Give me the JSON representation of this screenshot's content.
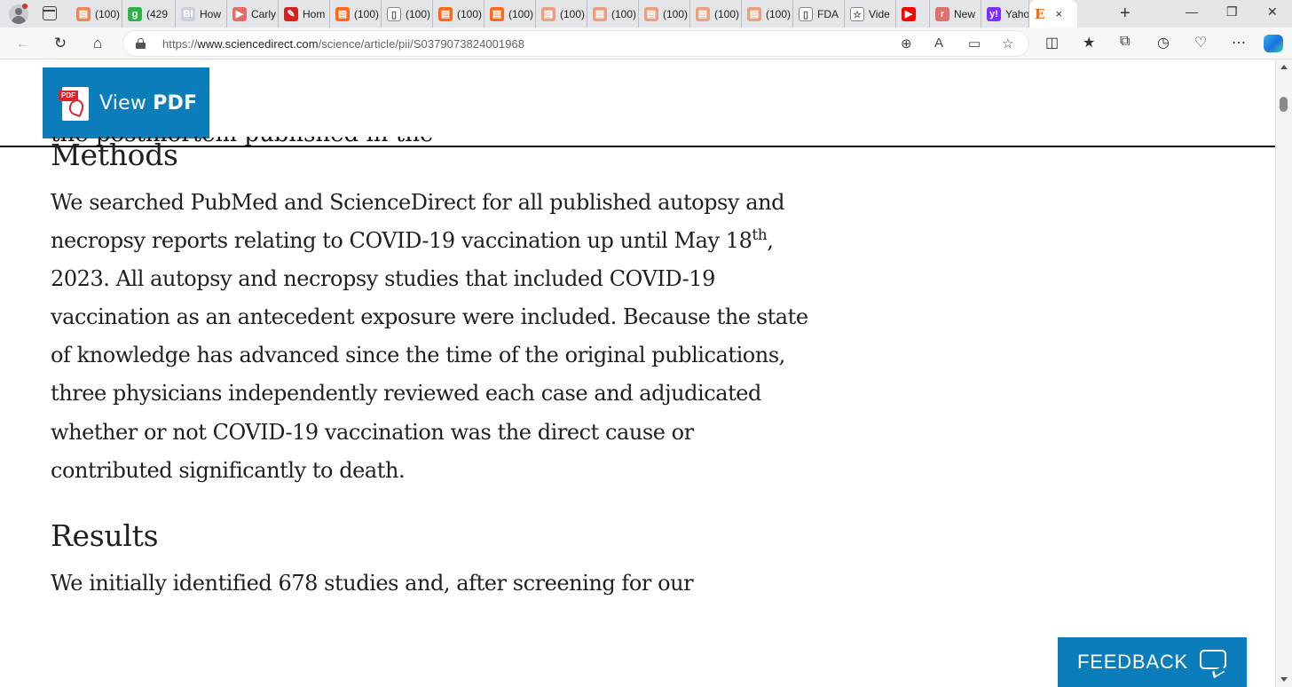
{
  "browser": {
    "tabs": [
      {
        "title": "(100)",
        "icon": "substack-icon",
        "color": "#e8875a"
      },
      {
        "title": "(429",
        "icon": "g-icon",
        "color": "#2fb24b"
      },
      {
        "title": "How",
        "icon": "bi-icon",
        "color": "#c9d0de"
      },
      {
        "title": "Carly",
        "icon": "youtube-icon",
        "color": "#e66a6a"
      },
      {
        "title": "Hom",
        "icon": "pin-icon",
        "color": "#d32020"
      },
      {
        "title": "(100)",
        "icon": "substack-icon",
        "color": "#ff6719"
      },
      {
        "title": "(100)",
        "icon": "page-icon",
        "color": "#ffffff"
      },
      {
        "title": "(100)",
        "icon": "substack-icon",
        "color": "#ff6719"
      },
      {
        "title": "(100)",
        "icon": "substack-icon",
        "color": "#ff6719"
      },
      {
        "title": "(100)",
        "icon": "substack-icon",
        "color": "#e8a080"
      },
      {
        "title": "(100)",
        "icon": "substack-icon",
        "color": "#e8a080"
      },
      {
        "title": "(100)",
        "icon": "substack-icon",
        "color": "#e8a080"
      },
      {
        "title": "(100)",
        "icon": "substack-icon",
        "color": "#e8a080"
      },
      {
        "title": "(100)",
        "icon": "substack-icon",
        "color": "#e8a080"
      },
      {
        "title": "FDA",
        "icon": "page-icon",
        "color": "#ffffff"
      },
      {
        "title": "Vide",
        "icon": "star-icon",
        "color": "#ffffff"
      },
      {
        "title": "",
        "icon": "youtube-icon",
        "color": "#ff0000"
      },
      {
        "title": "New",
        "icon": "news-icon",
        "color": "#e07070"
      },
      {
        "title": "Yaho",
        "icon": "yahoo-icon",
        "color": "#7d2eff"
      }
    ],
    "active_tab": {
      "title": "E",
      "close": "×"
    },
    "new_tab": "+",
    "window_controls": {
      "minimize": "—",
      "restore": "❐",
      "close": "✕"
    },
    "url_prefix": "https://",
    "url_host": "www.sciencedirect.com",
    "url_path": "/science/article/pii/S0379073824001968"
  },
  "page": {
    "view_pdf": {
      "icon_tag": "PDF",
      "label_plain": "View ",
      "label_bold": "PDF"
    },
    "clipped_line": "the postmortem published in the journal,",
    "methods": {
      "heading": "Methods",
      "text_before_sup": "We searched PubMed and ScienceDirect for all published autopsy and necropsy reports relating to COVID-19 vaccination up until May 18",
      "sup": "th",
      "text_after_sup": ", 2023. All autopsy and necropsy studies that included COVID-19 vaccination as an antecedent exposure were included. Because the state of knowledge has advanced since the time of the original publications, three physicians independently reviewed each case and adjudicated whether or not COVID-19 vaccination was the direct cause or contributed significantly to death."
    },
    "results": {
      "heading": "Results",
      "text": "We initially identified 678 studies and, after screening for our"
    },
    "feedback": {
      "label": "FEEDBACK"
    }
  },
  "colors": {
    "brand_blue": "#0c7dbb",
    "pdf_red": "#d9232e"
  }
}
